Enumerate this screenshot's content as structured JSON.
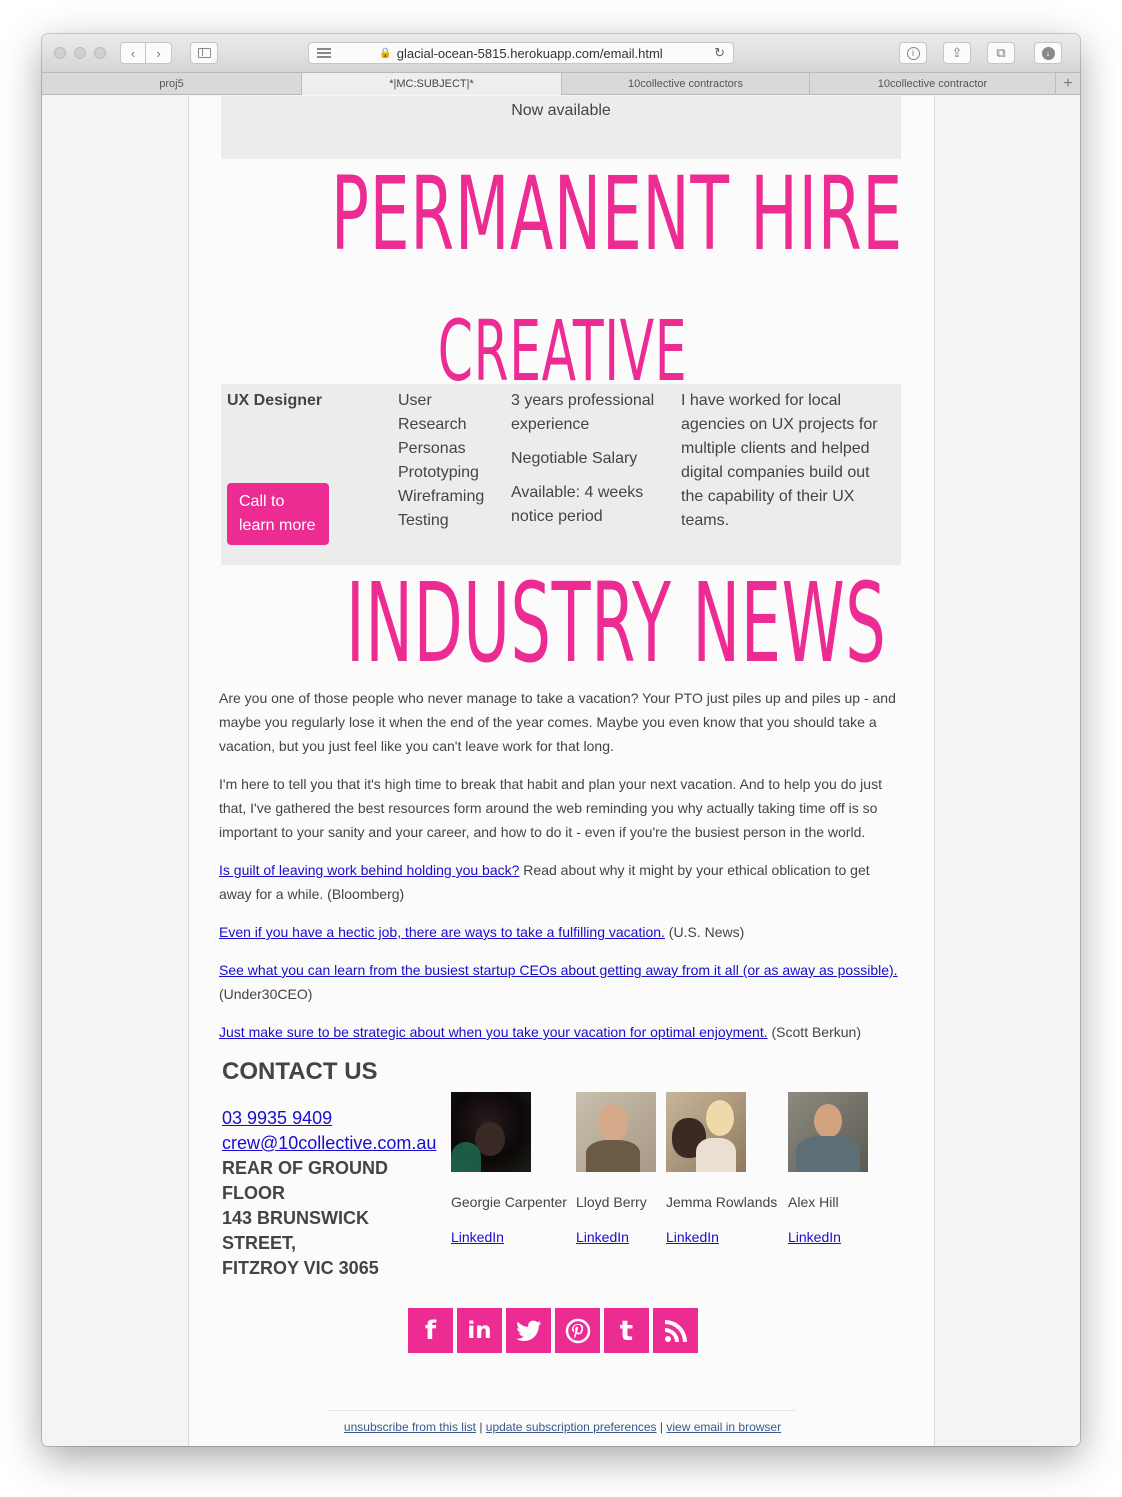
{
  "browser": {
    "url": "glacial-ocean-5815.herokuapp.com/email.html",
    "tabs": [
      "proj5",
      "*|MC:SUBJECT|*",
      "10collective contractors",
      "10collective contractor"
    ],
    "new_tab": "+"
  },
  "email": {
    "banner": "Now available",
    "heading_permanent": "PERMANENT HIRE",
    "heading_creative": "CREATIVE",
    "job": {
      "title": "UX Designer",
      "cta": "Call to learn more",
      "skills": [
        "User Research",
        "Personas",
        "Prototyping",
        "Wireframing",
        "Testing"
      ],
      "details": [
        "3 years professional experience",
        "Negotiable Salary",
        "Available: 4 weeks notice period"
      ],
      "description": "I have worked for local agencies on UX projects for multiple clients and helped digital companies build out the capability of their UX teams."
    },
    "heading_news": "INDUSTRY NEWS",
    "news": {
      "p1": "Are you one of those people who never manage to take a vacation? Your PTO just piles up and piles up - and maybe you regularly lose it when the end of the year comes. Maybe you even know that you should take a vacation, but you just feel like you can't leave work for that long.",
      "p2": "I'm here to tell you that it's high time to break that habit and plan your next vacation. And to help you do just that, I've gathered the best resources form around the web reminding you why actually taking time off is so important to your sanity and your career, and how to do it - even if you're the busiest person in the world.",
      "items": [
        {
          "link": "Is guilt of leaving work behind holding you back?",
          "text": " Read about why it might by your ethical oblication to get away for a while. (Bloomberg)"
        },
        {
          "link": "Even if you have a hectic job, there are ways to take a fulfilling vacation.",
          "text": " (U.S. News)"
        },
        {
          "link": "See what you can learn from the busiest startup CEOs about getting away from it all (or as away as possible).",
          "text": " (Under30CEO)"
        },
        {
          "link": "Just make sure to be strategic about when you take your vacation for optimal enjoyment.",
          "text": " (Scott Berkun)"
        }
      ]
    },
    "contact": {
      "heading": "CONTACT US",
      "phone": "03 9935 9409",
      "email": "crew@10collective.com.au",
      "address_lines": [
        "REAR OF GROUND FLOOR",
        "143 BRUNSWICK STREET,",
        "FITZROY VIC 3065"
      ]
    },
    "team": [
      {
        "name": "Georgie Carpenter",
        "link": "LinkedIn"
      },
      {
        "name": "Lloyd Berry",
        "link": "LinkedIn"
      },
      {
        "name": "Jemma Rowlands",
        "link": "LinkedIn"
      },
      {
        "name": "Alex Hill",
        "link": "LinkedIn"
      }
    ],
    "social": [
      "facebook-icon",
      "linkedin-icon",
      "twitter-icon",
      "pinterest-icon",
      "tumblr-icon",
      "rss-icon"
    ],
    "footer": {
      "unsubscribe": "unsubscribe from this list",
      "preferences": "update subscription preferences",
      "view_in_browser": "view email in browser",
      "separator": "|"
    },
    "accent_color": "#ec2c93"
  }
}
